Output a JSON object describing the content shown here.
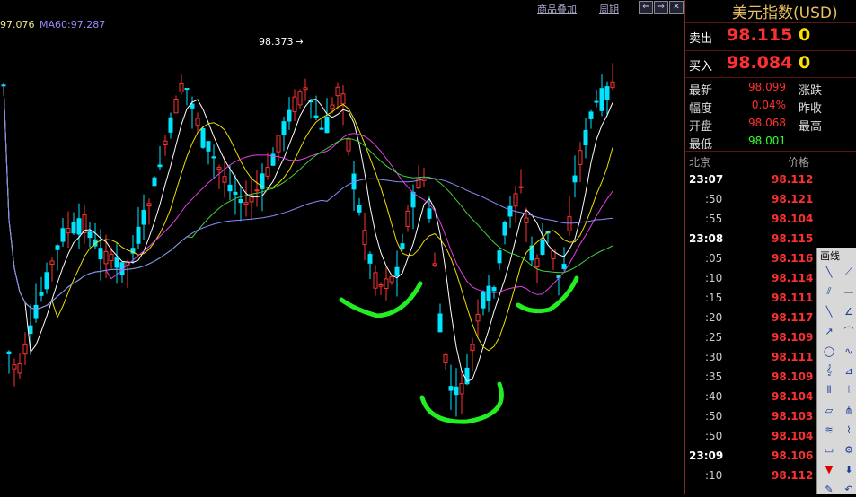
{
  "ma_labels": [
    {
      "text": "97.076",
      "color": "#f0e68c"
    },
    {
      "text": "MA60:97.287",
      "color": "#9a8aff"
    }
  ],
  "toolbar": {
    "overlay_label": "商品叠加",
    "period_label": "周期",
    "nav_icons": [
      "arrow-left-icon",
      "arrow-right-icon",
      "close-icon"
    ]
  },
  "high_marker": {
    "label": "98.373"
  },
  "quote_panel": {
    "title": "美元指数(USD)",
    "sell": {
      "label": "卖出",
      "price": "98.115",
      "volume": "0"
    },
    "buy": {
      "label": "买入",
      "price": "98.084",
      "volume": "0"
    },
    "stats": [
      {
        "label": "最新",
        "value": "98.099",
        "color": "#ff3030",
        "label2": "涨跌"
      },
      {
        "label": "幅度",
        "value": "0.04%",
        "color": "#ff3030",
        "label2": "昨收"
      },
      {
        "label": "开盘",
        "value": "98.068",
        "color": "#ff3030",
        "label2": "最高"
      },
      {
        "label": "最低",
        "value": "98.001",
        "color": "#30ff30",
        "label2": ""
      }
    ],
    "ticks_header": {
      "time": "北京",
      "price": "价格"
    },
    "ticks": [
      {
        "time": "23:07",
        "full": true,
        "price": "98.112"
      },
      {
        "time": ":50",
        "full": false,
        "price": "98.121"
      },
      {
        "time": ":55",
        "full": false,
        "price": "98.104"
      },
      {
        "time": "23:08",
        "full": true,
        "price": "98.115"
      },
      {
        "time": ":05",
        "full": false,
        "price": "98.116"
      },
      {
        "time": ":10",
        "full": false,
        "price": "98.114"
      },
      {
        "time": ":15",
        "full": false,
        "price": "98.111"
      },
      {
        "time": ":20",
        "full": false,
        "price": "98.117"
      },
      {
        "time": ":25",
        "full": false,
        "price": "98.109"
      },
      {
        "time": ":30",
        "full": false,
        "price": "98.111"
      },
      {
        "time": ":35",
        "full": false,
        "price": "98.109"
      },
      {
        "time": ":40",
        "full": false,
        "price": "98.104"
      },
      {
        "time": ":50",
        "full": false,
        "price": "98.103"
      },
      {
        "time": ":50",
        "full": false,
        "price": "98.104"
      },
      {
        "time": "23:09",
        "full": true,
        "price": "98.106"
      },
      {
        "time": ":10",
        "full": false,
        "price": "98.112"
      }
    ]
  },
  "draw_panel": {
    "title": "画线",
    "tools": [
      "line-segment-icon",
      "ray-icon",
      "parallel-lines-icon",
      "horizontal-line-icon",
      "trend-line-icon",
      "angle-line-icon",
      "arrow-line-icon",
      "arc-icon",
      "ellipse-icon",
      "wave-icon",
      "fibonacci-icon",
      "fib-fan-icon",
      "gann-line-icon",
      "cycle-lines-icon",
      "channel-icon",
      "pitchfork-icon",
      "speed-lines-icon",
      "rainbow-icon",
      "ruler-icon",
      "gear-icon",
      "up-arrow-mark-icon",
      "down-arrow-mark-icon",
      "pencil-icon",
      "undo-icon"
    ]
  },
  "colors": {
    "up": "#ff3232",
    "down": "#00e5ff",
    "ma5": "#ffffff",
    "ma10": "#f0e000",
    "ma20": "#e040e0",
    "ma30": "#40d040",
    "ma60": "#8a8aff",
    "annotation": "#22ee22"
  }
}
